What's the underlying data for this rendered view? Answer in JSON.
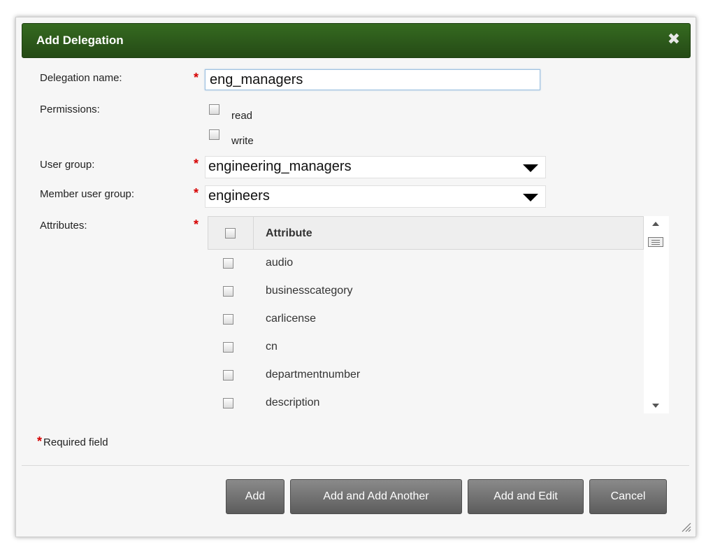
{
  "dialog": {
    "title": "Add Delegation"
  },
  "fields": {
    "delegation_name_label": "Delegation name:",
    "delegation_name_value": "eng_managers",
    "permissions_label": "Permissions:",
    "permission_read": "read",
    "permission_write": "write",
    "user_group_label": "User group:",
    "user_group_value": "engineering_managers",
    "member_user_group_label": "Member user group:",
    "member_user_group_value": "engineers",
    "attributes_label": "Attributes:",
    "required_marker": "*"
  },
  "attributes_table": {
    "header": "Attribute",
    "rows": [
      "audio",
      "businesscategory",
      "carlicense",
      "cn",
      "departmentnumber",
      "description"
    ]
  },
  "footer": {
    "required_note": "Required field",
    "buttons": {
      "add": "Add",
      "add_another": "Add and Add Another",
      "add_edit": "Add and Edit",
      "cancel": "Cancel"
    }
  },
  "colors": {
    "titlebar": "#2e5b1c",
    "required": "#d60000",
    "button": "#6b6b6b"
  },
  "icons": {
    "close": "close-icon",
    "dropdown": "chevron-down-icon",
    "resize": "resize-grip-icon"
  }
}
